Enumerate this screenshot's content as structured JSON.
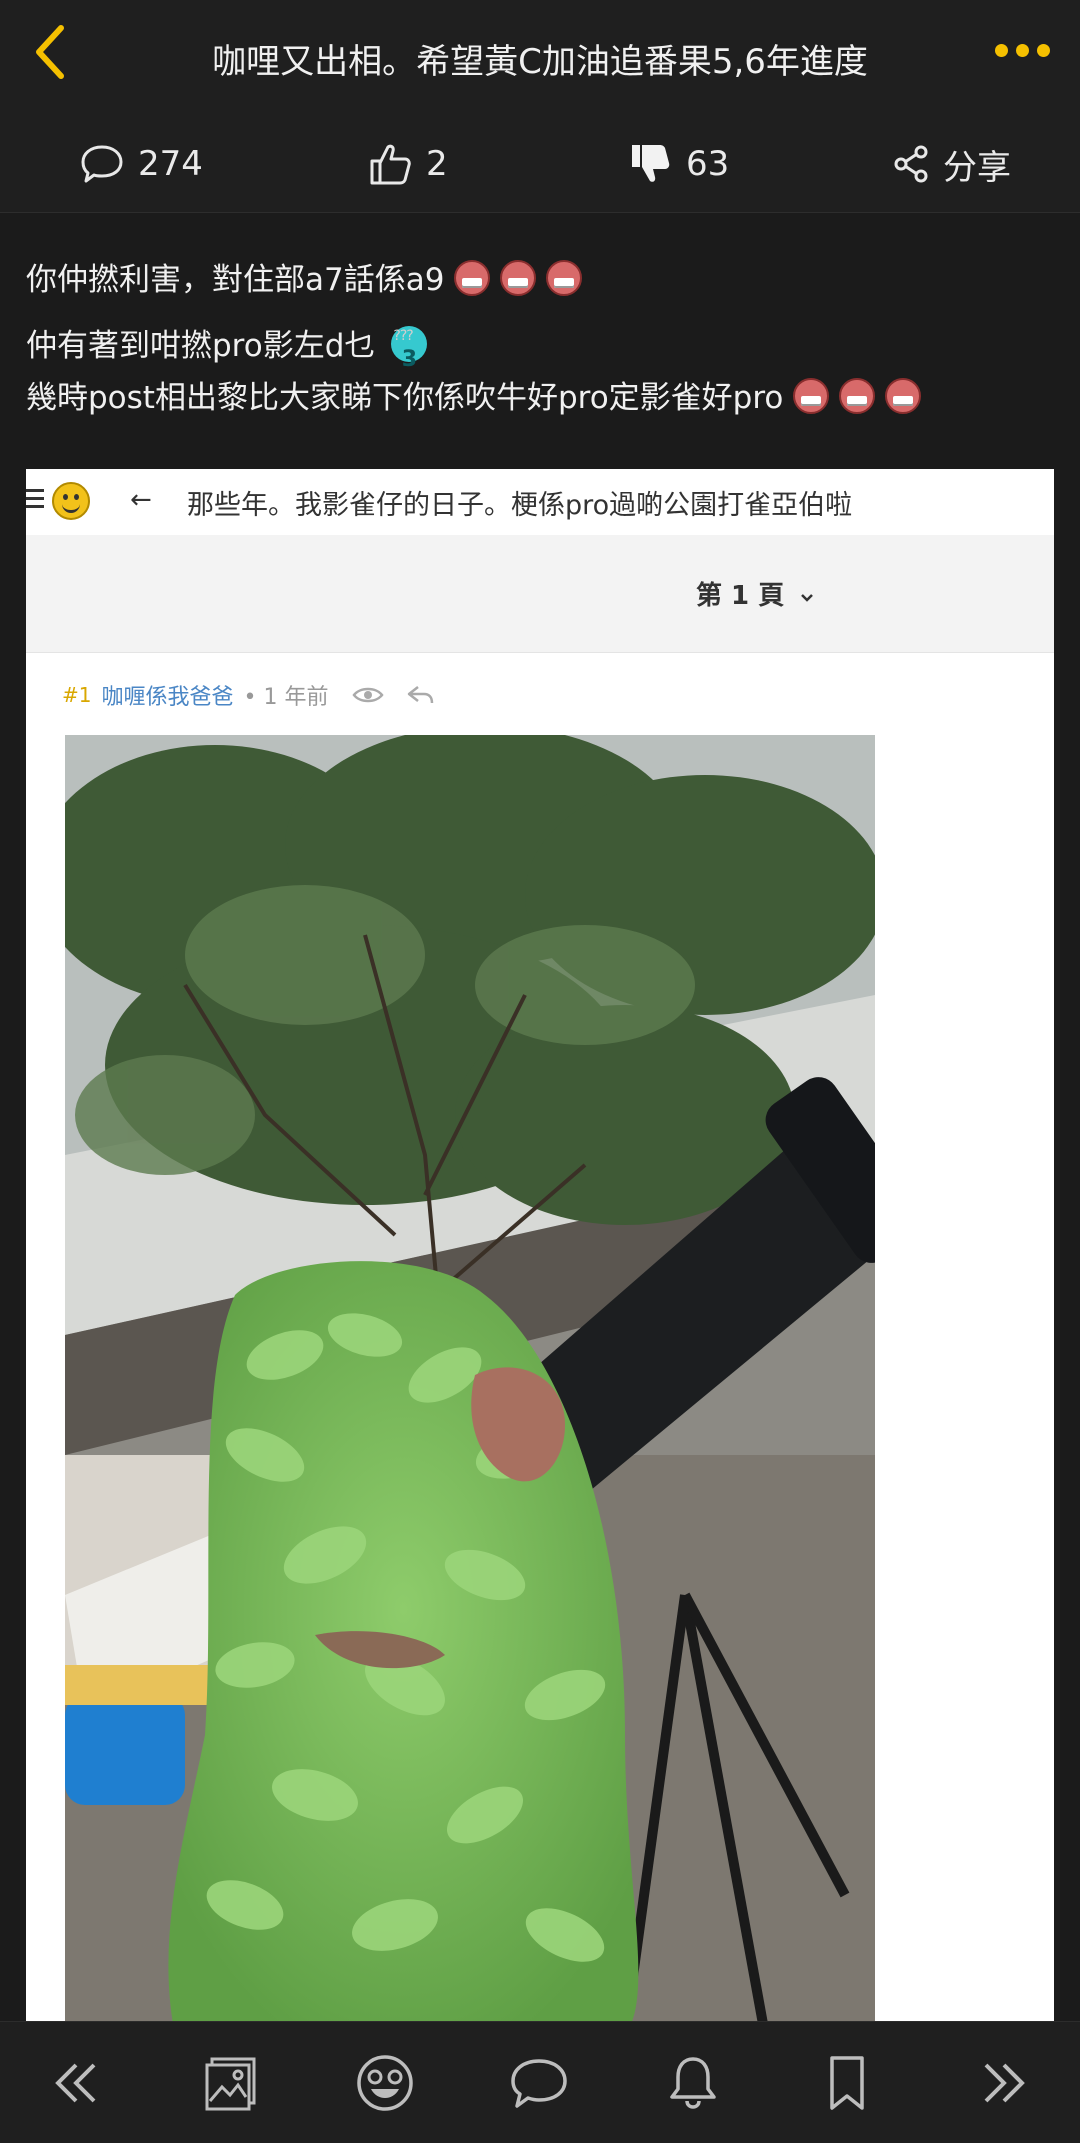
{
  "header": {
    "title": "咖哩又出相。希望黃C加油追番果5,6年進度"
  },
  "stats": {
    "comments": "274",
    "likes": "2",
    "dislikes": "63",
    "share_label": "分享"
  },
  "post": {
    "lines": [
      "你仲撚利害，對住部a7話係a9",
      "仲有著到咁撚pro影左d乜",
      "幾時post相出黎比大家睇下你係吹牛好pro定影雀好pro"
    ]
  },
  "embedded": {
    "thread_title": "那些年。我影雀仔的日子。梗係pro過啲公園打雀亞伯啦",
    "page_label": "第 1 頁",
    "reply_number": "#1",
    "username": "咖喱係我爸爸",
    "time_ago": "• 1 年前"
  },
  "icons": {
    "back": "chevron-left-icon",
    "more": "more-dots-icon",
    "comment": "speech-bubble-icon",
    "like": "thumbs-up-icon",
    "dislike": "thumbs-down-icon",
    "share": "share-icon"
  },
  "colors": {
    "accent": "#f5c000",
    "background": "#1b1b1b",
    "bar": "#1f1f1f"
  }
}
